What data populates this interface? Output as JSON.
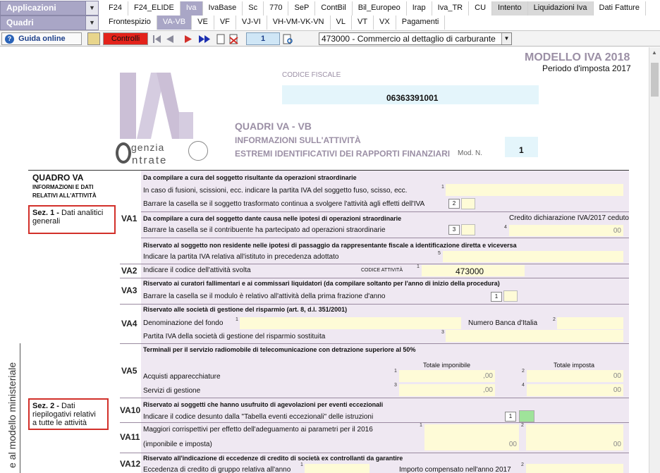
{
  "menubar": {
    "row1_label": "Applicazioni",
    "row2_label": "Quadri",
    "tabs_row1": [
      "F24",
      "F24_ELIDE",
      "Iva",
      "IvaBase",
      "Sc",
      "770",
      "SeP",
      "ContBil",
      "Bil_Europeo",
      "Irap",
      "Iva_TR",
      "CU",
      "Intento",
      "Liquidazioni Iva",
      "Dati Fatture"
    ],
    "tabs_row2": [
      "Frontespizio",
      "VA-VB",
      "VE",
      "VF",
      "VJ-VI",
      "VH-VM-VK-VN",
      "VL",
      "VT",
      "VX",
      "Pagamenti"
    ]
  },
  "toolbar": {
    "guida": "Guida online",
    "controlli": "Controlli",
    "page_num": "1",
    "activity": "473000 - Commercio al dettaglio di carburante"
  },
  "header": {
    "model_title": "MODELLO IVA 2018",
    "period": "Periodo d'imposta 2017",
    "cf_label": "CODICE FISCALE",
    "cf_value": "06363391001",
    "logo_agenzia": "genzia",
    "logo_entrate": "ntrate",
    "title1": "QUADRI VA - VB",
    "title2": "INFORMAZIONI SULL'ATTIVITÀ",
    "title3": "ESTREMI IDENTIFICATIVI DEI RAPPORTI FINANZIARI",
    "mod_n_label": "Mod. N.",
    "mod_n_value": "1"
  },
  "quadro": {
    "title": "QUADRO VA",
    "subtitle1": "INFORMAZIONI E DATI",
    "subtitle2": "RELATIVI ALL'ATTIVITÀ",
    "sez1_a": "Sez. 1 -",
    "sez1_b": "Dati analitici",
    "sez1_c": "generali",
    "sez2_a": "Sez. 2 -",
    "sez2_b": "Dati",
    "sez2_c": "riepilogativi relativi",
    "sez2_d": "a tutte le attività",
    "vertical": "e al modello ministeriale"
  },
  "rows": {
    "va1_code": "VA1",
    "va1_h1": "Da compilare a cura del soggetto risultante da operazioni straordinarie",
    "va1_t1": "In caso di fusioni, scissioni, ecc. indicare la partita IVA del soggetto fuso, scisso, ecc.",
    "va1_t2": "Barrare la casella se il soggetto trasformato continua a svolgere l'attività agli effetti dell'IVA",
    "va1_h2": "Da compilare a cura del soggetto dante causa nelle ipotesi di operazioni straordinarie",
    "va1_credito": "Credito dichiarazione IVA/2017 ceduto",
    "va1_t3": "Barrare la casella se il contribuente ha partecipato ad operazioni straordinarie",
    "va1_h3": "Riservato al soggetto non residente nelle ipotesi di passaggio da rappresentante fiscale a identificazione diretta e viceversa",
    "va1_t4": "Indicare la partita IVA relativa all'istituto in precedenza adottato",
    "va2_code": "VA2",
    "va2_t": "Indicare il codice dell'attività svolta",
    "va2_lbl": "CODICE ATTIVITÀ",
    "va2_val": "473000",
    "va3_code": "VA3",
    "va3_h": "Riservato ai curatori fallimentari e ai commissari liquidatori  (da compilare soltanto per l'anno di inizio della procedura)",
    "va3_t": "Barrare la casella se il modulo è relativo all'attività della prima frazione d'anno",
    "va4_code": "VA4",
    "va4_h": "Riservato alle società di gestione del risparmio  (art. 8, d.l. 351/2001)",
    "va4_t1": "Denominazione del fondo",
    "va4_t2": "Numero Banca d'Italia",
    "va4_t3": "Partita IVA della società di gestione del risparmio sostituita",
    "va5_code": "VA5",
    "va5_h": "Terminali per il servizio radiomobile di telecomunicazione con detrazione superiore al 50%",
    "va5_col1": "Totale imponibile",
    "va5_col2": "Totale imposta",
    "va5_t1": "Acquisti apparecchiature",
    "va5_t2": "Servizi di gestione",
    "va10_code": "VA10",
    "va10_h": "Riservato ai soggetti che hanno usufruito di agevolazioni per eventi eccezionali",
    "va10_t": "Indicare il codice desunto dalla \"Tabella eventi eccezionali\" delle istruzioni",
    "va11_code": "VA11",
    "va11_t1": "Maggiori corrispettivi per effetto dell'adeguamento ai parametri per il 2016",
    "va11_t2": "(imponibile e imposta)",
    "va12_code": "VA12",
    "va12_h": "Riservato all'indicazione di eccedenze di credito di società ex controllanti da garantire",
    "va12_t1": "Eccedenza di credito di gruppo relativa all'anno",
    "va12_t2": "Importo compensato nell'anno 2017",
    "dec00": "00",
    "dec_comma00": ",00"
  },
  "colors": {
    "accent": "#a9a6c6",
    "lavender": "#efe8f2",
    "field": "#fefbd7",
    "cf": "#e4f5fb",
    "red": "#e3231b",
    "title": "#9b8fa5"
  }
}
